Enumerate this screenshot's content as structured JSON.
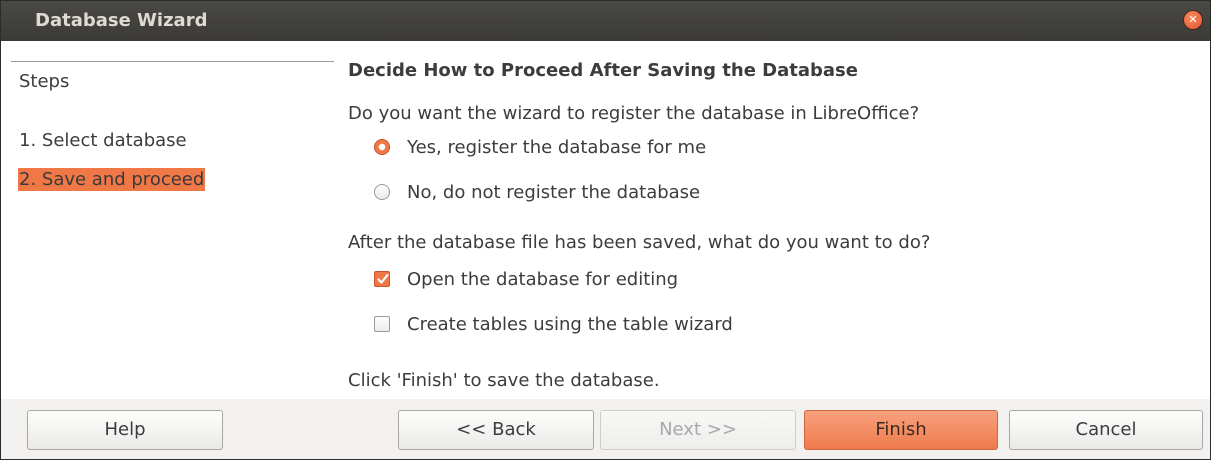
{
  "window": {
    "title": "Database Wizard"
  },
  "steps": {
    "title": "Steps",
    "items": [
      {
        "label": "1. Select database",
        "active": false
      },
      {
        "label": "2. Save and proceed",
        "active": true
      }
    ]
  },
  "main": {
    "heading": "Decide How to Proceed After Saving the Database",
    "register_question": "Do you want the wizard to register the database in LibreOffice?",
    "register_yes": "Yes, register the database for me",
    "register_no": "No, do not register the database",
    "after_question": "After the database file has been saved, what do you want to do?",
    "open_for_editing": "Open the database for editing",
    "create_tables": "Create tables using the table wizard",
    "finish_hint": "Click 'Finish' to save the database."
  },
  "state": {
    "register": "yes",
    "open_for_editing": true,
    "create_tables": false
  },
  "buttons": {
    "help": "Help",
    "back": "<< Back",
    "next": "Next >>",
    "finish": "Finish",
    "cancel": "Cancel"
  },
  "colors": {
    "accent": "#f07746",
    "titlebar": "#3b3a36"
  }
}
